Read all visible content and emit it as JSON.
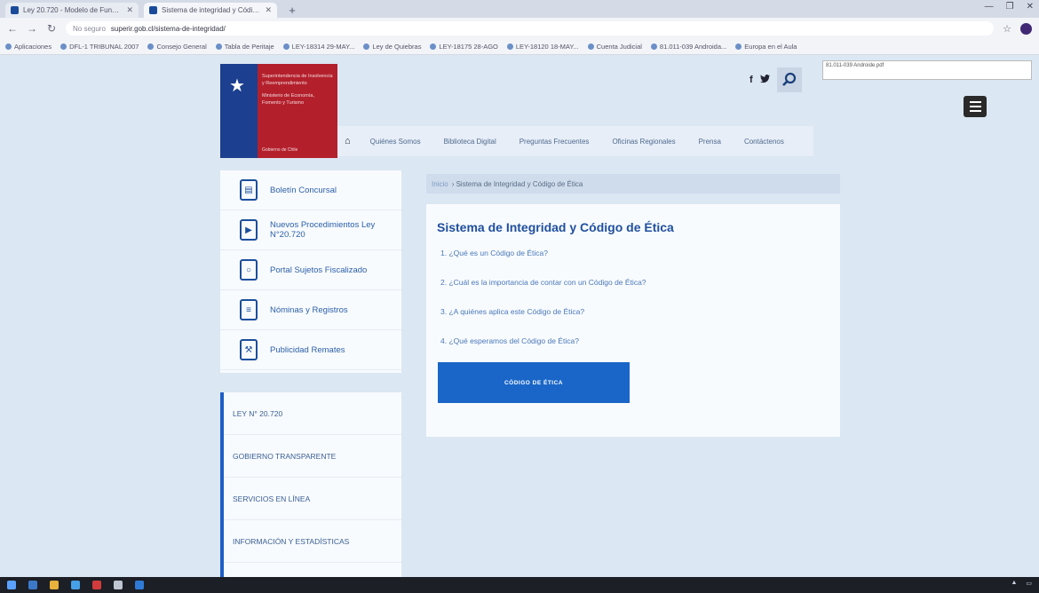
{
  "browser": {
    "tabs": [
      {
        "title": "Ley 20.720 - Modelo de Funciones"
      },
      {
        "title": "Sistema de integridad y Código"
      }
    ],
    "url_security": "No seguro",
    "url": "superir.gob.cl/sistema-de-integridad/",
    "bookmarks": [
      "Aplicaciones",
      "DFL-1 TRIBUNAL 2007",
      "Consejo General",
      "Tabla de Peritaje",
      "LEY-18314 29-MAY...",
      "Ley de Quiebras",
      "LEY-18175 28-AGO",
      "LEY-18120 18-MAY...",
      "Cuenta Judicial",
      "81.011-039 Androida...",
      "Europa en el Aula"
    ],
    "download_tooltip": "81.011-039 Androide.pdf"
  },
  "header": {
    "logo_text": "Superintendencia de Insolvencia y Reemprendimiento",
    "logo_sub": "Ministerio de Economía, Fomento y Turismo",
    "logo_foot": "Gobierno de Chile",
    "social": {
      "facebook": "f",
      "twitter": "t"
    }
  },
  "nav": {
    "items": [
      "Quiénes Somos",
      "Biblioteca Digital",
      "Preguntas Frecuentes",
      "Oficinas Regionales",
      "Prensa",
      "Contáctenos"
    ]
  },
  "services": [
    {
      "label": "Boletín Concursal",
      "icon": "bulletin-icon"
    },
    {
      "label": "Nuevos Procedimientos Ley N°20.720",
      "icon": "folder-play-icon"
    },
    {
      "label": "Portal Sujetos Fiscalizado",
      "icon": "monitor-search-icon"
    },
    {
      "label": "Nóminas y Registros",
      "icon": "document-list-icon"
    },
    {
      "label": "Publicidad Remates",
      "icon": "gavel-icon"
    }
  ],
  "sidelinks": [
    "LEY N° 20.720",
    "GOBIERNO TRANSPARENTE",
    "SERVICIOS EN LÍNEA",
    "INFORMACIÓN Y ESTADÍSTICAS"
  ],
  "breadcrumb": {
    "home": "Inicio",
    "current": "Sistema de Integridad y Código de Ética"
  },
  "content": {
    "title": "Sistema de Integridad y Código de Ética",
    "questions": [
      "1. ¿Qué es un Código de Ética?",
      "2. ¿Cuál es la importancia de contar con un Código de Ética?",
      "3. ¿A quiénes aplica este Código de Ética?",
      "4. ¿Qué esperamos del Código de Ética?"
    ],
    "cta_label": "CÓDIGO DE ÉTICA"
  },
  "colors": {
    "primary": "#1a66c8",
    "logo_red": "#b3202c",
    "logo_blue": "#1c3f8f"
  }
}
